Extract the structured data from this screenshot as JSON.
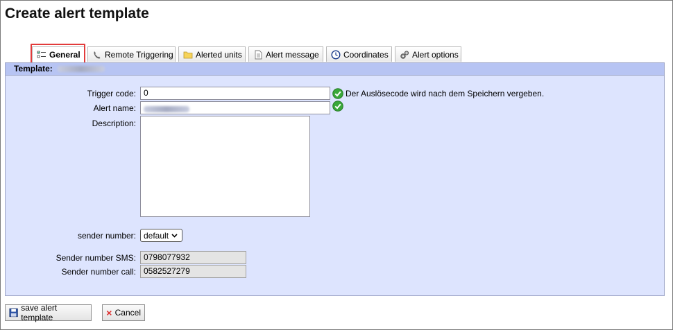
{
  "page": {
    "title": "Create alert template"
  },
  "tabs": [
    {
      "label": "General",
      "icon": "checklist-icon"
    },
    {
      "label": "Remote Triggering",
      "icon": "phone-icon"
    },
    {
      "label": "Alerted units",
      "icon": "folder-icon"
    },
    {
      "label": "Alert message",
      "icon": "document-icon"
    },
    {
      "label": "Coordinates",
      "icon": "compass-icon"
    },
    {
      "label": "Alert options",
      "icon": "gears-icon"
    }
  ],
  "panel": {
    "template_label": "Template:"
  },
  "form": {
    "trigger_code": {
      "label": "Trigger code:",
      "value": "0",
      "hint": "Der Auslösecode wird nach dem Speichern vergeben."
    },
    "alert_name": {
      "label": "Alert name:"
    },
    "description": {
      "label": "Description:",
      "value": ""
    },
    "sender_number": {
      "label": "sender number:",
      "selected": "default"
    },
    "sender_sms": {
      "label": "Sender number SMS:",
      "value": "0798077932"
    },
    "sender_call": {
      "label": "Sender number call:",
      "value": "0582527279"
    }
  },
  "buttons": {
    "save_label": "save alert template",
    "cancel_label": "Cancel"
  },
  "colors": {
    "panel_bg": "#dde4fe",
    "panel_header": "#b7c4f3",
    "highlight": "#e23b3b",
    "check_green": "#3aa83a"
  }
}
